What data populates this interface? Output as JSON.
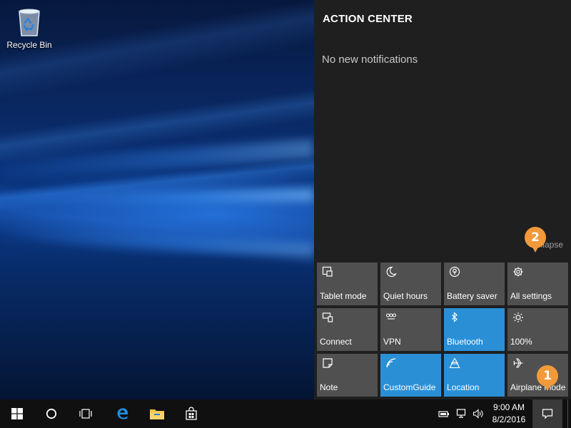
{
  "desktop": {
    "icons": [
      {
        "label": "Recycle Bin",
        "icon": "recycle-bin-icon"
      }
    ]
  },
  "action_center": {
    "title": "ACTION CENTER",
    "empty_message": "No new notifications",
    "collapse_label": "Collapse",
    "tiles": [
      {
        "label": "Tablet mode",
        "icon": "tablet-mode-icon",
        "active": false
      },
      {
        "label": "Quiet hours",
        "icon": "moon-icon",
        "active": false
      },
      {
        "label": "Battery saver",
        "icon": "battery-saver-icon",
        "active": false
      },
      {
        "label": "All settings",
        "icon": "gear-icon",
        "active": false
      },
      {
        "label": "Connect",
        "icon": "connect-icon",
        "active": false
      },
      {
        "label": "VPN",
        "icon": "vpn-icon",
        "active": false
      },
      {
        "label": "Bluetooth",
        "icon": "bluetooth-icon",
        "active": true
      },
      {
        "label": "100%",
        "icon": "brightness-icon",
        "active": false
      },
      {
        "label": "Note",
        "icon": "note-icon",
        "active": false
      },
      {
        "label": "CustomGuide",
        "icon": "wifi-icon",
        "active": true
      },
      {
        "label": "Location",
        "icon": "location-icon",
        "active": true
      },
      {
        "label": "Airplane mode",
        "icon": "airplane-icon",
        "active": false
      }
    ]
  },
  "callouts": {
    "one": "1",
    "two": "2"
  },
  "taskbar": {
    "clock": {
      "time": "9:00 AM",
      "date": "8/2/2016"
    }
  },
  "colors": {
    "accent": "#2b8fd6",
    "tile": "#505050",
    "panel": "#1f1f1f",
    "callout": "#f29a3a"
  }
}
